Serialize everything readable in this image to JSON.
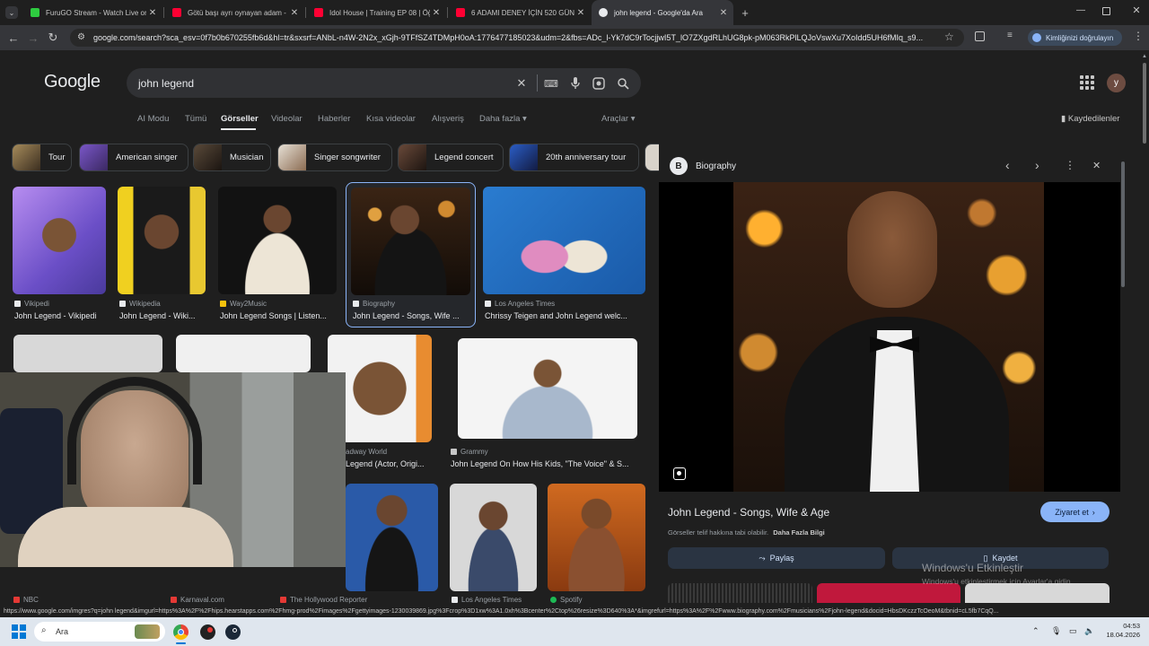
{
  "tabs": [
    {
      "title": "FuruGO Stream - Watch Live on",
      "fav": "#2ecc40",
      "active": false
    },
    {
      "title": "Götü başı ayrı oynayan adam -",
      "fav": "#ff0033",
      "active": false
    },
    {
      "title": "Idol House | Training EP 08 | Öğ",
      "fav": "#ff0033",
      "active": false
    },
    {
      "title": "6 ADAMI DENEY İÇİN 520 GÜN",
      "fav": "#ff0033",
      "active": false
    },
    {
      "title": "john legend - Google'da Ara",
      "fav": "#e8eaed",
      "active": true
    }
  ],
  "toolbar": {
    "url": "google.com/search?sca_esv=0f7b0b670255fb6d&hl=tr&sxsrf=ANbL-n4W-2N2x_xGjh-9TFfSZ4TDMpH0oA:1776477185023&udm=2&fbs=ADc_l-Yk7dC9rTocjjwI5T_lO7ZXgdRLhUG8pk-pM063RkPlLQJoVswXu7XoIdd5UH6fMIq_s9...",
    "verify_label": "Kimliğinizi doğrulayın"
  },
  "google": {
    "logo": "Google",
    "query": "john legend",
    "avatar_letter": "y"
  },
  "nav": {
    "items": [
      "AI Modu",
      "Tümü",
      "Görseller",
      "Videolar",
      "Haberler",
      "Kısa videolar",
      "Alışveriş",
      "Daha fazla ▾"
    ],
    "tools": "Araçlar ▾",
    "saved": "Kaydedilenler"
  },
  "chips": [
    "Tour",
    "American singer",
    "Musician",
    "Singer songwriter",
    "Legend concert",
    "20th anniversary tour"
  ],
  "results_row1": [
    {
      "source": "Vikipedi",
      "caption": "John Legend - Vikipedi"
    },
    {
      "source": "Wikipedia",
      "caption": "John Legend - Wiki..."
    },
    {
      "source": "Way2Music",
      "caption": "John Legend Songs | Listen..."
    },
    {
      "source": "Biography",
      "caption": "John Legend - Songs, Wife ..."
    },
    {
      "source": "Los Angeles Times",
      "caption": "Chrissy Teigen and John Legend welc..."
    }
  ],
  "results_row2": [
    {
      "source": "adway World",
      "caption": "Legend (Actor, Origi..."
    },
    {
      "source": "Grammy",
      "caption": "John Legend On How His Kids, \"The Voice\" & S..."
    }
  ],
  "results_row3": [
    {
      "source": "NBC"
    },
    {
      "source": "Karnaval.com"
    },
    {
      "source": "The Hollywood Reporter"
    },
    {
      "source": "Los Angeles Times"
    },
    {
      "source": "Spotify"
    }
  ],
  "panel": {
    "source": "Biography",
    "title": "John Legend - Songs, Wife & Age",
    "visit": "Ziyaret et",
    "note": "Görseller telif hakkına tabi olabilir.",
    "note_link": "Daha Fazla Bilgi",
    "share": "Paylaş",
    "save": "Kaydet"
  },
  "watermark": {
    "line1": "Windows'u Etkinleştir",
    "line2": "Windows'u etkinleştirmek için Ayarlar'a gidin."
  },
  "status_url": "https://www.google.com/imgres?q=john legend&imgurl=https%3A%2F%2Fhips.hearstapps.com%2Fhmg-prod%2Fimages%2Fgettyimages-1230039869.jpg%3Fcrop%3D1xw%3A1.0xh%3Bcenter%2Ctop%26resize%3D640%3A*&imgrefurl=https%3A%2F%2Fwww.biography.com%2Fmusicians%2Fjohn-legend&docid=HbsDKczzTcOeoM&tbnid=cL5fb7CqQ...",
  "taskbar": {
    "search": "Ara",
    "time": "04:53",
    "date": "18.04.2026"
  }
}
